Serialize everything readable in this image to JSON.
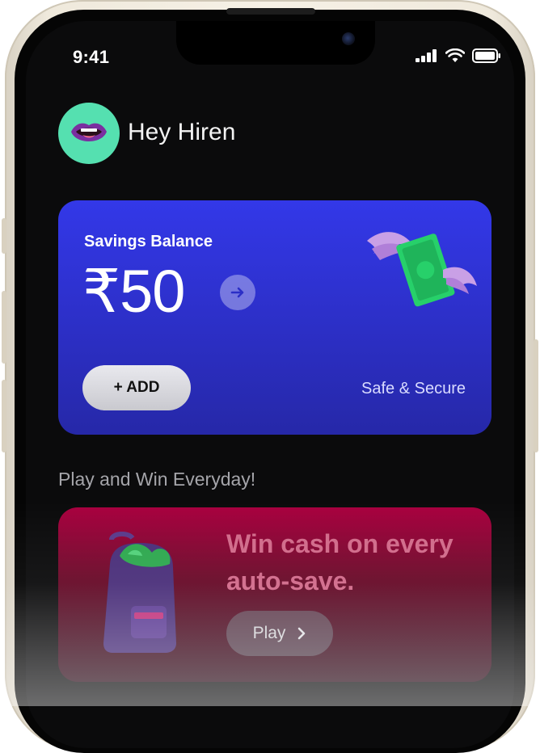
{
  "status_bar": {
    "time": "9:41"
  },
  "user": {
    "greeting": "Hey Hiren"
  },
  "savings": {
    "label": "Savings Balance",
    "amount": "₹50",
    "add_label": "+ ADD",
    "security_note": "Safe & Secure"
  },
  "section": {
    "title": "Play and Win Everyday!"
  },
  "promo": {
    "headline": "Win cash on every auto-save.",
    "play_label": "Play"
  },
  "colors": {
    "card_blue": "#3338e8",
    "avatar_green": "#55e0b0",
    "promo_crimson": "#a8003f"
  },
  "icons": [
    "lips-avatar-icon",
    "signal-icon",
    "wifi-icon",
    "battery-icon",
    "arrow-right-icon",
    "flying-money-icon",
    "backpack-icon",
    "chevron-right-icon"
  ]
}
